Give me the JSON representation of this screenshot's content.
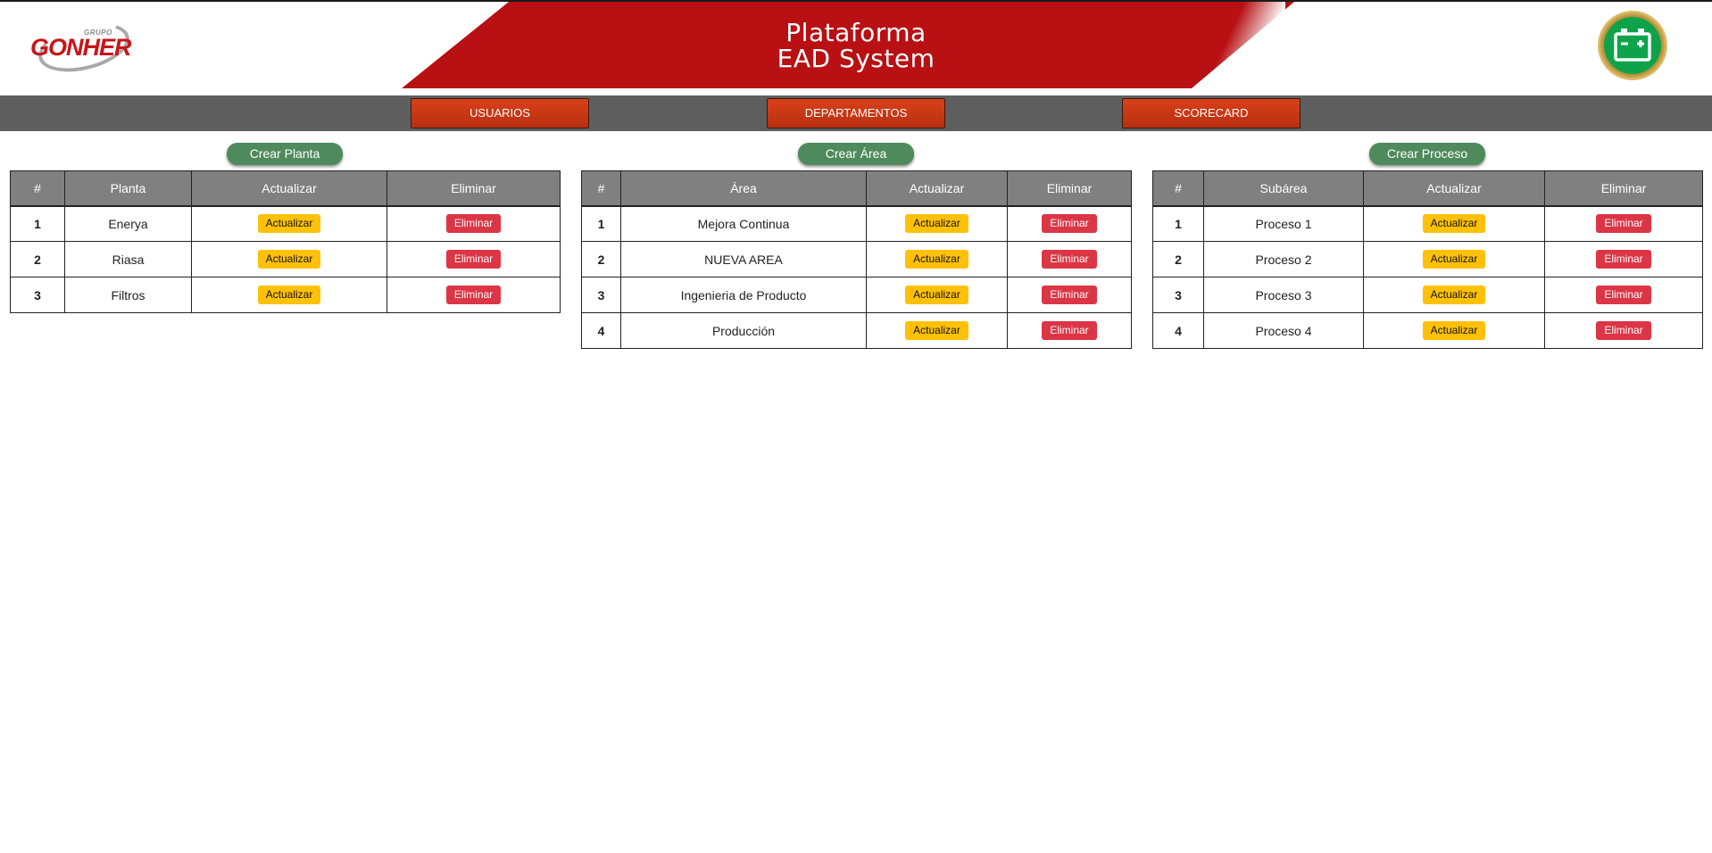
{
  "header": {
    "title_line1": "Plataforma",
    "title_line2": "EAD System",
    "logo_brand": "GONHER",
    "logo_group": "GRUPO",
    "badge_icon": "battery-icon"
  },
  "nav": {
    "items": [
      {
        "label": "USUARIOS"
      },
      {
        "label": "DEPARTAMENTOS"
      },
      {
        "label": "SCORECARD"
      }
    ]
  },
  "colors": {
    "banner_red": "#b81013",
    "nav_bg": "#5e5e5e",
    "nav_button": "#d9401a",
    "create_button": "#4f8a5c",
    "update_button": "#ffc107",
    "delete_button": "#dc3545",
    "badge_green": "#0ea34a"
  },
  "plantas": {
    "create_label": "Crear Planta",
    "headers": [
      "#",
      "Planta",
      "Actualizar",
      "Eliminar"
    ],
    "rows": [
      {
        "num": "1",
        "name": "Enerya",
        "update": "Actualizar",
        "delete": "Eliminar"
      },
      {
        "num": "2",
        "name": "Riasa",
        "update": "Actualizar",
        "delete": "Eliminar"
      },
      {
        "num": "3",
        "name": "Filtros",
        "update": "Actualizar",
        "delete": "Eliminar"
      }
    ]
  },
  "areas": {
    "create_label": "Crear Área",
    "headers": [
      "#",
      "Área",
      "Actualizar",
      "Eliminar"
    ],
    "rows": [
      {
        "num": "1",
        "name": "Mejora Continua",
        "update": "Actualizar",
        "delete": "Eliminar"
      },
      {
        "num": "2",
        "name": "NUEVA AREA",
        "update": "Actualizar",
        "delete": "Eliminar"
      },
      {
        "num": "3",
        "name": "Ingenieria de Producto",
        "update": "Actualizar",
        "delete": "Eliminar"
      },
      {
        "num": "4",
        "name": "Producción",
        "update": "Actualizar",
        "delete": "Eliminar"
      }
    ]
  },
  "procesos": {
    "create_label": "Crear Proceso",
    "headers": [
      "#",
      "Subárea",
      "Actualizar",
      "Eliminar"
    ],
    "rows": [
      {
        "num": "1",
        "name": "Proceso 1",
        "update": "Actualizar",
        "delete": "Eliminar"
      },
      {
        "num": "2",
        "name": "Proceso 2",
        "update": "Actualizar",
        "delete": "Eliminar"
      },
      {
        "num": "3",
        "name": "Proceso 3",
        "update": "Actualizar",
        "delete": "Eliminar"
      },
      {
        "num": "4",
        "name": "Proceso 4",
        "update": "Actualizar",
        "delete": "Eliminar"
      }
    ]
  }
}
